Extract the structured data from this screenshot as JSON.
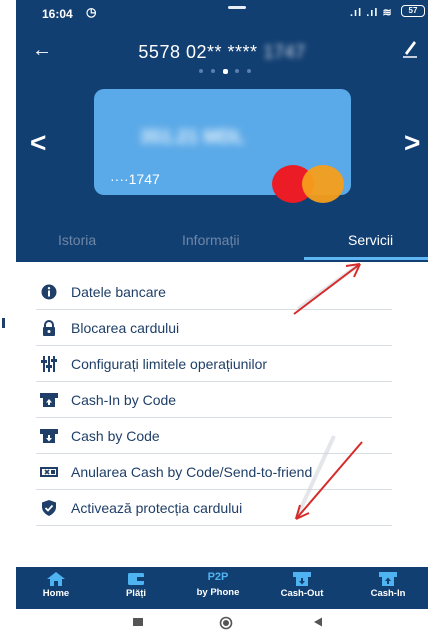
{
  "status_bar": {
    "time": "16:04",
    "battery": "57"
  },
  "header": {
    "card_number": "5578 02** ****",
    "card_number_tail": "1747"
  },
  "card": {
    "balance": "351.21 MDL",
    "last4": "····1747",
    "brand_icon": "mastercard-logo"
  },
  "tabs": [
    {
      "label": "Istoria",
      "active": false
    },
    {
      "label": "Informații",
      "active": false
    },
    {
      "label": "Servicii",
      "active": true
    }
  ],
  "services": [
    {
      "label": "Datele bancare",
      "icon": "info-icon"
    },
    {
      "label": "Blocarea cardului",
      "icon": "lock-icon"
    },
    {
      "label": "Configurați limitele operațiunilor",
      "icon": "sliders-icon"
    },
    {
      "label": "Cash-In by Code",
      "icon": "cash-in-icon"
    },
    {
      "label": "Cash by Code",
      "icon": "cash-out-icon"
    },
    {
      "label": "Anularea Cash by Code/Send-to-friend",
      "icon": "cancel-cash-icon"
    },
    {
      "label": "Activează protecția cardului",
      "icon": "shield-icon"
    }
  ],
  "bottom_nav": [
    {
      "label": "Home",
      "icon": "home-icon"
    },
    {
      "label": "Plăți",
      "icon": "wallet-icon"
    },
    {
      "label": "by Phone",
      "icon_text": "P2P"
    },
    {
      "label": "Cash-Out",
      "icon": "atm-out-icon"
    },
    {
      "label": "Cash-In",
      "icon": "atm-in-icon"
    }
  ],
  "colors": {
    "primary": "#123f72",
    "card": "#5aa9e8",
    "accent": "#5fb6f4",
    "text": "#1f3f68",
    "annotation_arrow": "#d62b2b"
  }
}
